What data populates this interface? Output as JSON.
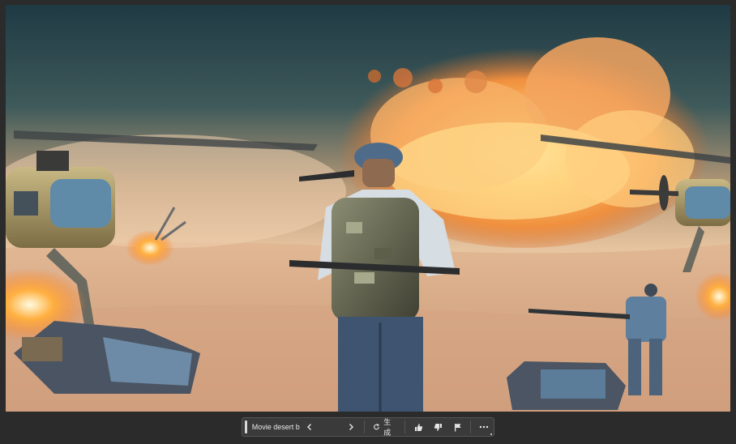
{
  "canvas": {
    "image_name": "desert-battle-image"
  },
  "toolbar": {
    "prompt_text": "Movie desert battle",
    "prev_icon": "chevron-left-icon",
    "next_icon": "chevron-right-icon",
    "generate_icon": "refresh-icon",
    "generate_label": "生成",
    "like_icon": "thumbs-up-icon",
    "dislike_icon": "thumbs-down-icon",
    "flag_icon": "flag-icon",
    "more_icon": "more-horizontal-icon"
  },
  "colors": {
    "window_bg": "#2b2b2b",
    "toolbar_bg": "#3a3a3a",
    "toolbar_text": "#e6e6e6"
  }
}
